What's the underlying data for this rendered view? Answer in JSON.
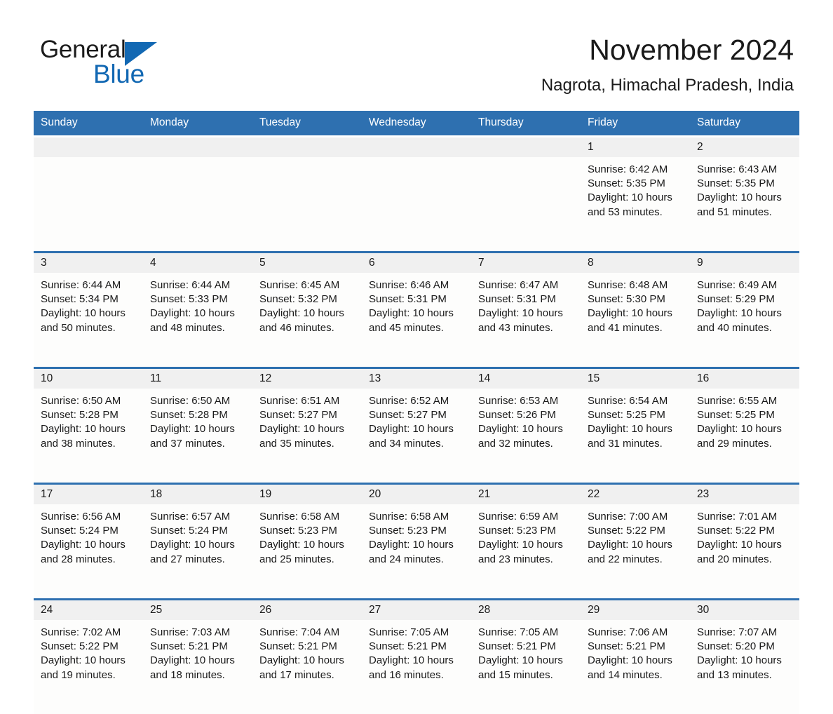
{
  "brand": {
    "name_part1": "General",
    "name_part2": "Blue",
    "logo_triangle_color": "#1268b3",
    "accent_color": "#2e70b0"
  },
  "header": {
    "title": "November 2024",
    "subtitle": "Nagrota, Himachal Pradesh, India"
  },
  "calendar": {
    "weekday_headers": [
      "Sunday",
      "Monday",
      "Tuesday",
      "Wednesday",
      "Thursday",
      "Friday",
      "Saturday"
    ],
    "weeks": [
      [
        {
          "day": "",
          "lines": []
        },
        {
          "day": "",
          "lines": []
        },
        {
          "day": "",
          "lines": []
        },
        {
          "day": "",
          "lines": []
        },
        {
          "day": "",
          "lines": []
        },
        {
          "day": "1",
          "lines": [
            "Sunrise: 6:42 AM",
            "Sunset: 5:35 PM",
            "Daylight: 10 hours and 53 minutes."
          ]
        },
        {
          "day": "2",
          "lines": [
            "Sunrise: 6:43 AM",
            "Sunset: 5:35 PM",
            "Daylight: 10 hours and 51 minutes."
          ]
        }
      ],
      [
        {
          "day": "3",
          "lines": [
            "Sunrise: 6:44 AM",
            "Sunset: 5:34 PM",
            "Daylight: 10 hours and 50 minutes."
          ]
        },
        {
          "day": "4",
          "lines": [
            "Sunrise: 6:44 AM",
            "Sunset: 5:33 PM",
            "Daylight: 10 hours and 48 minutes."
          ]
        },
        {
          "day": "5",
          "lines": [
            "Sunrise: 6:45 AM",
            "Sunset: 5:32 PM",
            "Daylight: 10 hours and 46 minutes."
          ]
        },
        {
          "day": "6",
          "lines": [
            "Sunrise: 6:46 AM",
            "Sunset: 5:31 PM",
            "Daylight: 10 hours and 45 minutes."
          ]
        },
        {
          "day": "7",
          "lines": [
            "Sunrise: 6:47 AM",
            "Sunset: 5:31 PM",
            "Daylight: 10 hours and 43 minutes."
          ]
        },
        {
          "day": "8",
          "lines": [
            "Sunrise: 6:48 AM",
            "Sunset: 5:30 PM",
            "Daylight: 10 hours and 41 minutes."
          ]
        },
        {
          "day": "9",
          "lines": [
            "Sunrise: 6:49 AM",
            "Sunset: 5:29 PM",
            "Daylight: 10 hours and 40 minutes."
          ]
        }
      ],
      [
        {
          "day": "10",
          "lines": [
            "Sunrise: 6:50 AM",
            "Sunset: 5:28 PM",
            "Daylight: 10 hours and 38 minutes."
          ]
        },
        {
          "day": "11",
          "lines": [
            "Sunrise: 6:50 AM",
            "Sunset: 5:28 PM",
            "Daylight: 10 hours and 37 minutes."
          ]
        },
        {
          "day": "12",
          "lines": [
            "Sunrise: 6:51 AM",
            "Sunset: 5:27 PM",
            "Daylight: 10 hours and 35 minutes."
          ]
        },
        {
          "day": "13",
          "lines": [
            "Sunrise: 6:52 AM",
            "Sunset: 5:27 PM",
            "Daylight: 10 hours and 34 minutes."
          ]
        },
        {
          "day": "14",
          "lines": [
            "Sunrise: 6:53 AM",
            "Sunset: 5:26 PM",
            "Daylight: 10 hours and 32 minutes."
          ]
        },
        {
          "day": "15",
          "lines": [
            "Sunrise: 6:54 AM",
            "Sunset: 5:25 PM",
            "Daylight: 10 hours and 31 minutes."
          ]
        },
        {
          "day": "16",
          "lines": [
            "Sunrise: 6:55 AM",
            "Sunset: 5:25 PM",
            "Daylight: 10 hours and 29 minutes."
          ]
        }
      ],
      [
        {
          "day": "17",
          "lines": [
            "Sunrise: 6:56 AM",
            "Sunset: 5:24 PM",
            "Daylight: 10 hours and 28 minutes."
          ]
        },
        {
          "day": "18",
          "lines": [
            "Sunrise: 6:57 AM",
            "Sunset: 5:24 PM",
            "Daylight: 10 hours and 27 minutes."
          ]
        },
        {
          "day": "19",
          "lines": [
            "Sunrise: 6:58 AM",
            "Sunset: 5:23 PM",
            "Daylight: 10 hours and 25 minutes."
          ]
        },
        {
          "day": "20",
          "lines": [
            "Sunrise: 6:58 AM",
            "Sunset: 5:23 PM",
            "Daylight: 10 hours and 24 minutes."
          ]
        },
        {
          "day": "21",
          "lines": [
            "Sunrise: 6:59 AM",
            "Sunset: 5:23 PM",
            "Daylight: 10 hours and 23 minutes."
          ]
        },
        {
          "day": "22",
          "lines": [
            "Sunrise: 7:00 AM",
            "Sunset: 5:22 PM",
            "Daylight: 10 hours and 22 minutes."
          ]
        },
        {
          "day": "23",
          "lines": [
            "Sunrise: 7:01 AM",
            "Sunset: 5:22 PM",
            "Daylight: 10 hours and 20 minutes."
          ]
        }
      ],
      [
        {
          "day": "24",
          "lines": [
            "Sunrise: 7:02 AM",
            "Sunset: 5:22 PM",
            "Daylight: 10 hours and 19 minutes."
          ]
        },
        {
          "day": "25",
          "lines": [
            "Sunrise: 7:03 AM",
            "Sunset: 5:21 PM",
            "Daylight: 10 hours and 18 minutes."
          ]
        },
        {
          "day": "26",
          "lines": [
            "Sunrise: 7:04 AM",
            "Sunset: 5:21 PM",
            "Daylight: 10 hours and 17 minutes."
          ]
        },
        {
          "day": "27",
          "lines": [
            "Sunrise: 7:05 AM",
            "Sunset: 5:21 PM",
            "Daylight: 10 hours and 16 minutes."
          ]
        },
        {
          "day": "28",
          "lines": [
            "Sunrise: 7:05 AM",
            "Sunset: 5:21 PM",
            "Daylight: 10 hours and 15 minutes."
          ]
        },
        {
          "day": "29",
          "lines": [
            "Sunrise: 7:06 AM",
            "Sunset: 5:21 PM",
            "Daylight: 10 hours and 14 minutes."
          ]
        },
        {
          "day": "30",
          "lines": [
            "Sunrise: 7:07 AM",
            "Sunset: 5:20 PM",
            "Daylight: 10 hours and 13 minutes."
          ]
        }
      ]
    ]
  }
}
